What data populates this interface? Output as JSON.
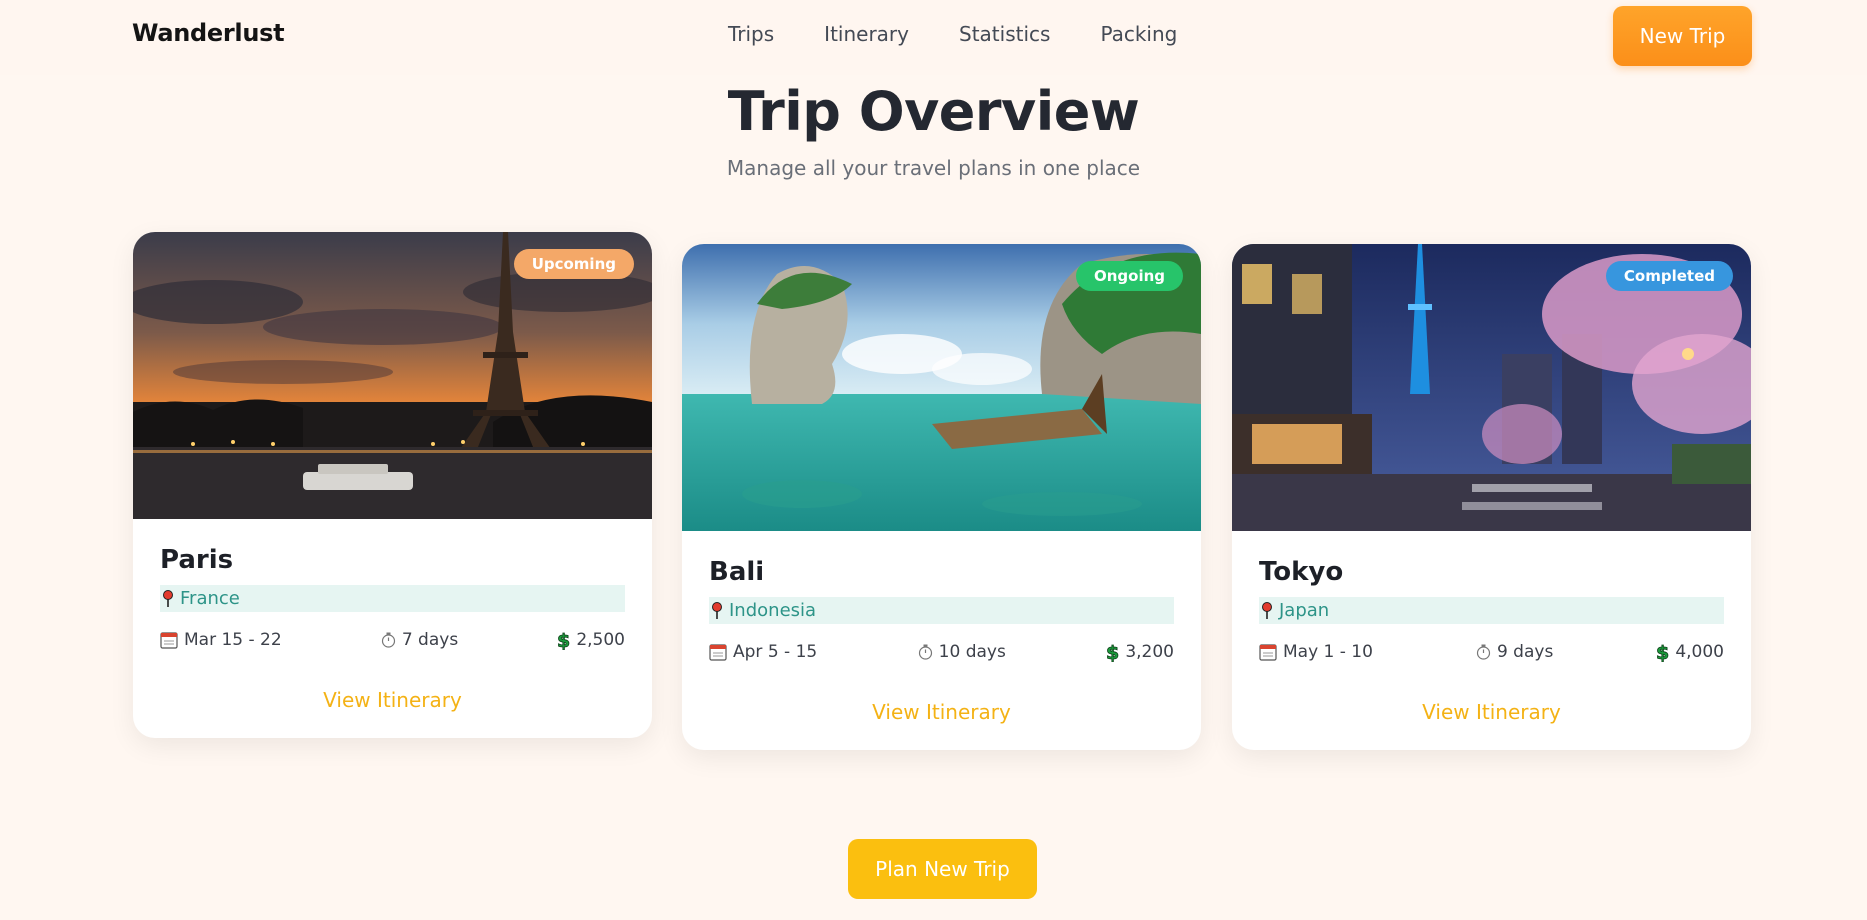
{
  "nav": {
    "brand": "Wanderlust",
    "links": [
      "Trips",
      "Itinerary",
      "Statistics",
      "Packing"
    ],
    "new_trip_label": "New Trip"
  },
  "header": {
    "title": "Trip Overview",
    "subtitle": "Manage all your travel plans in one place"
  },
  "trips": [
    {
      "city": "Paris",
      "country": "France",
      "status": "Upcoming",
      "status_color": "#f4a868",
      "dates": "Mar 15 - 22",
      "duration": "7 days",
      "budget": "2,500",
      "link": "View Itinerary"
    },
    {
      "city": "Bali",
      "country": "Indonesia",
      "status": "Ongoing",
      "status_color": "#27c46a",
      "dates": "Apr 5 - 15",
      "duration": "10 days",
      "budget": "3,200",
      "link": "View Itinerary"
    },
    {
      "city": "Tokyo",
      "country": "Japan",
      "status": "Completed",
      "status_color": "#3796de",
      "dates": "May 1 - 10",
      "duration": "9 days",
      "budget": "4,000",
      "link": "View Itinerary"
    }
  ],
  "icons": {
    "location": "pin-icon",
    "date": "calendar-icon",
    "duration": "stopwatch-icon",
    "budget": "dollar-icon"
  },
  "plan_button_label": "Plan New Trip"
}
